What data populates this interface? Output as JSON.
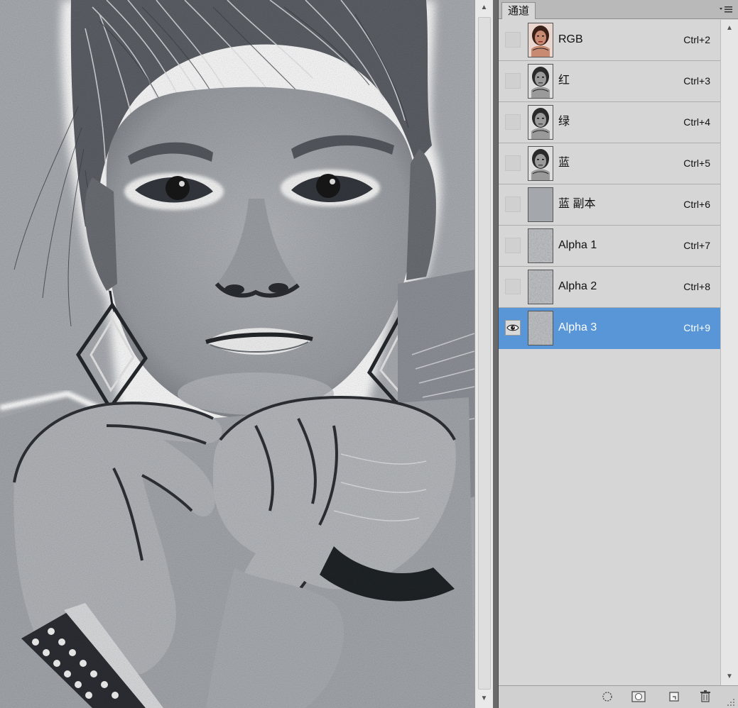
{
  "panel": {
    "tab_label": "通道",
    "menu_icon": "panel-menu-icon"
  },
  "channels": [
    {
      "name": "RGB",
      "shortcut": "Ctrl+2",
      "visible": false,
      "selected": false,
      "thumb": "color"
    },
    {
      "name": "红",
      "shortcut": "Ctrl+3",
      "visible": false,
      "selected": false,
      "thumb": "gray"
    },
    {
      "name": "绿",
      "shortcut": "Ctrl+4",
      "visible": false,
      "selected": false,
      "thumb": "gray"
    },
    {
      "name": "蓝",
      "shortcut": "Ctrl+5",
      "visible": false,
      "selected": false,
      "thumb": "gray"
    },
    {
      "name": "蓝 副本",
      "shortcut": "Ctrl+6",
      "visible": false,
      "selected": false,
      "thumb": "flat"
    },
    {
      "name": "Alpha 1",
      "shortcut": "Ctrl+7",
      "visible": false,
      "selected": false,
      "thumb": "noise"
    },
    {
      "name": "Alpha 2",
      "shortcut": "Ctrl+8",
      "visible": false,
      "selected": false,
      "thumb": "noise"
    },
    {
      "name": "Alpha 3",
      "shortcut": "Ctrl+9",
      "visible": true,
      "selected": true,
      "thumb": "noise"
    }
  ],
  "footer_buttons": [
    {
      "name": "load-selection-icon"
    },
    {
      "name": "save-selection-icon"
    },
    {
      "name": "new-channel-icon"
    },
    {
      "name": "delete-channel-icon"
    }
  ],
  "colors": {
    "selected_row": "#5896d8",
    "panel_bg": "#d6d6d6",
    "canvas_base": "#a7acb1"
  }
}
